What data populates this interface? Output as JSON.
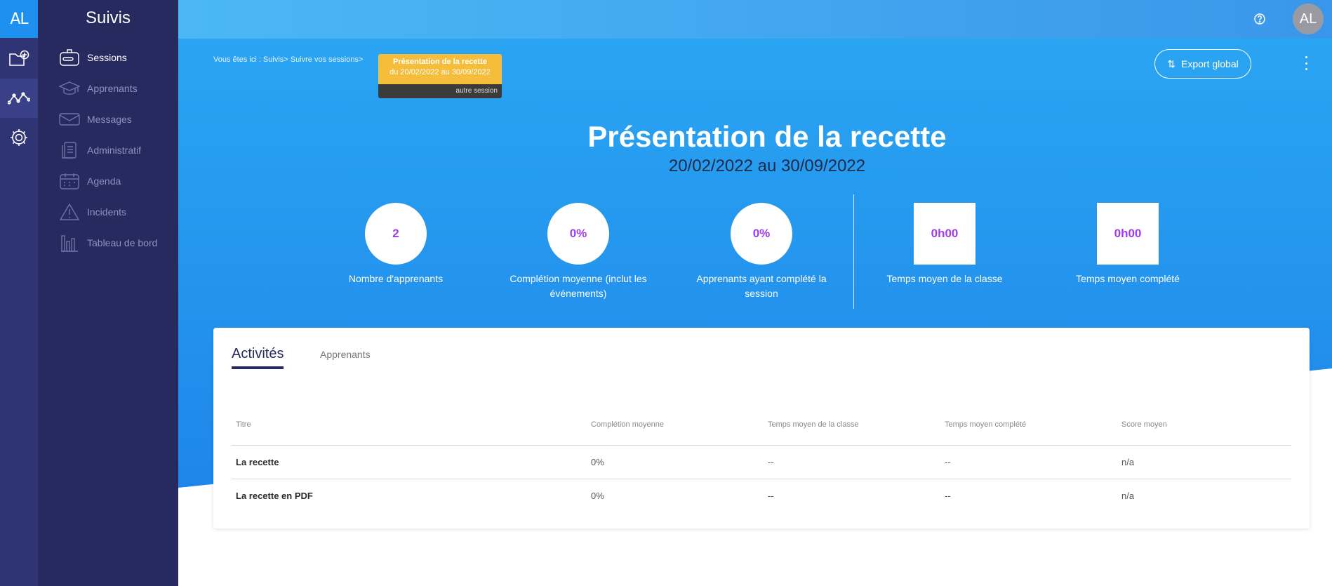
{
  "rail": {
    "logo": "AL",
    "items": [
      "folder-add-icon",
      "activity-icon",
      "gear-icon"
    ]
  },
  "sidebar": {
    "title": "Suivis",
    "items": [
      {
        "label": "Sessions",
        "icon": "sessions-icon",
        "active": true
      },
      {
        "label": "Apprenants",
        "icon": "graduation-cap-icon"
      },
      {
        "label": "Messages",
        "icon": "envelope-icon"
      },
      {
        "label": "Administratif",
        "icon": "document-icon"
      },
      {
        "label": "Agenda",
        "icon": "calendar-icon"
      },
      {
        "label": "Incidents",
        "icon": "warning-icon"
      },
      {
        "label": "Tableau de bord",
        "icon": "chart-icon"
      }
    ]
  },
  "header": {
    "avatar": "AL",
    "help_icon": "help-icon"
  },
  "breadcrumb": "Vous êtes ici : Suivis> Suivre vos sessions>",
  "session_card": {
    "title": "Présentation de la recette",
    "dates": "du 20/02/2022 au 30/09/2022",
    "link": "autre session"
  },
  "actions": {
    "export_label": "Export global"
  },
  "hero": {
    "title": "Présentation de la recette",
    "dates": "20/02/2022 au 30/09/2022"
  },
  "stats": [
    {
      "value": "2",
      "label": "Nombre d'apprenants",
      "shape": "circle"
    },
    {
      "value": "0%",
      "label": "Complétion moyenne (inclut les événements)",
      "shape": "circle"
    },
    {
      "value": "0%",
      "label": "Apprenants ayant complété la session",
      "shape": "circle"
    },
    {
      "value": "0h00",
      "label": "Temps moyen de la classe",
      "shape": "square"
    },
    {
      "value": "0h00",
      "label": "Temps moyen complété",
      "shape": "square"
    }
  ],
  "tabs": [
    {
      "label": "Activités",
      "active": true
    },
    {
      "label": "Apprenants",
      "active": false
    }
  ],
  "table": {
    "columns": [
      "Titre",
      "Complétion moyenne",
      "Temps moyen de la classe",
      "Temps moyen complété",
      "Score moyen"
    ],
    "rows": [
      [
        "La recette",
        "0%",
        "--",
        "--",
        "n/a"
      ],
      [
        "La recette en PDF",
        "0%",
        "--",
        "--",
        "n/a"
      ]
    ]
  },
  "colors": {
    "rail": "#2f3474",
    "sidebar": "#262a5e",
    "hero": "#1e90f0",
    "accent_value": "#a23be8",
    "session_card": "#f6bd3a"
  }
}
